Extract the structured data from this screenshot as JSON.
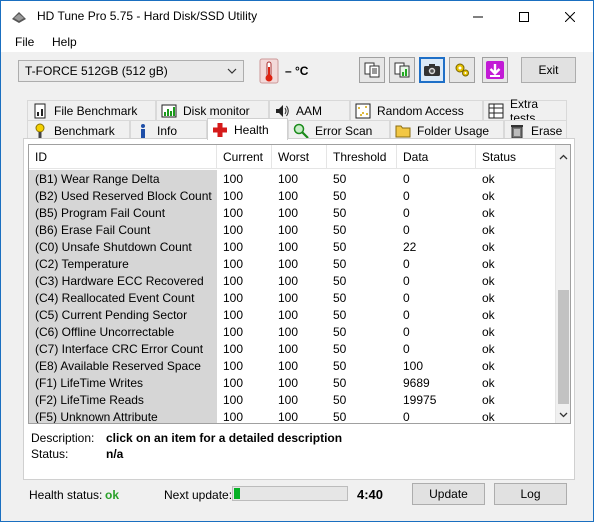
{
  "window": {
    "title": "HD Tune Pro 5.75 - Hard Disk/SSD Utility"
  },
  "menu": {
    "file": "File",
    "help": "Help"
  },
  "toolbar": {
    "drive": "T-FORCE 512GB (512 gB)",
    "temperature": "– °C",
    "exit_label": "Exit"
  },
  "tabs_row1": [
    {
      "label": "File Benchmark",
      "icon": "file-benchmark-icon"
    },
    {
      "label": "Disk monitor",
      "icon": "disk-monitor-icon"
    },
    {
      "label": "AAM",
      "icon": "speaker-icon"
    },
    {
      "label": "Random Access",
      "icon": "random-access-icon"
    },
    {
      "label": "Extra tests",
      "icon": "extra-tests-icon"
    }
  ],
  "tabs_row2": [
    {
      "label": "Benchmark",
      "icon": "benchmark-icon"
    },
    {
      "label": "Info",
      "icon": "info-icon"
    },
    {
      "label": "Health",
      "icon": "health-cross-icon",
      "active": true
    },
    {
      "label": "Error Scan",
      "icon": "magnifier-icon"
    },
    {
      "label": "Folder Usage",
      "icon": "folder-icon"
    },
    {
      "label": "Erase",
      "icon": "trash-icon"
    }
  ],
  "table": {
    "columns": [
      "ID",
      "Current",
      "Worst",
      "Threshold",
      "Data",
      "Status"
    ],
    "rows": [
      {
        "id": "(B1) Wear Range Delta",
        "current": "100",
        "worst": "100",
        "threshold": "50",
        "data": "0",
        "status": "ok"
      },
      {
        "id": "(B2) Used Reserved Block Count",
        "current": "100",
        "worst": "100",
        "threshold": "50",
        "data": "0",
        "status": "ok"
      },
      {
        "id": "(B5) Program Fail Count",
        "current": "100",
        "worst": "100",
        "threshold": "50",
        "data": "0",
        "status": "ok"
      },
      {
        "id": "(B6) Erase Fail Count",
        "current": "100",
        "worst": "100",
        "threshold": "50",
        "data": "0",
        "status": "ok"
      },
      {
        "id": "(C0) Unsafe Shutdown Count",
        "current": "100",
        "worst": "100",
        "threshold": "50",
        "data": "22",
        "status": "ok"
      },
      {
        "id": "(C2) Temperature",
        "current": "100",
        "worst": "100",
        "threshold": "50",
        "data": "0",
        "status": "ok"
      },
      {
        "id": "(C3) Hardware ECC Recovered",
        "current": "100",
        "worst": "100",
        "threshold": "50",
        "data": "0",
        "status": "ok"
      },
      {
        "id": "(C4) Reallocated Event Count",
        "current": "100",
        "worst": "100",
        "threshold": "50",
        "data": "0",
        "status": "ok"
      },
      {
        "id": "(C5) Current Pending Sector",
        "current": "100",
        "worst": "100",
        "threshold": "50",
        "data": "0",
        "status": "ok"
      },
      {
        "id": "(C6) Offline Uncorrectable",
        "current": "100",
        "worst": "100",
        "threshold": "50",
        "data": "0",
        "status": "ok"
      },
      {
        "id": "(C7) Interface CRC Error Count",
        "current": "100",
        "worst": "100",
        "threshold": "50",
        "data": "0",
        "status": "ok"
      },
      {
        "id": "(E8) Available Reserved Space",
        "current": "100",
        "worst": "100",
        "threshold": "50",
        "data": "100",
        "status": "ok"
      },
      {
        "id": "(F1) LifeTime Writes",
        "current": "100",
        "worst": "100",
        "threshold": "50",
        "data": "9689",
        "status": "ok"
      },
      {
        "id": "(F2) LifeTime Reads",
        "current": "100",
        "worst": "100",
        "threshold": "50",
        "data": "19975",
        "status": "ok"
      },
      {
        "id": "(F5) Unknown Attribute",
        "current": "100",
        "worst": "100",
        "threshold": "50",
        "data": "0",
        "status": "ok"
      }
    ]
  },
  "description": {
    "label": "Description:",
    "value": "click on an item for a detailed description",
    "status_label": "Status:",
    "status_value": "n/a"
  },
  "footer": {
    "health_label": "Health status:",
    "health_value": "ok",
    "next_update_label": "Next update:",
    "next_update_progress": 0.05,
    "countdown": "4:40",
    "update_label": "Update",
    "log_label": "Log"
  },
  "colors": {
    "health_ok": "#2aa12a",
    "progress": "#06b025",
    "id_column_bg": "#d6d6d6",
    "active_tool_border": "#1e6fc7"
  }
}
